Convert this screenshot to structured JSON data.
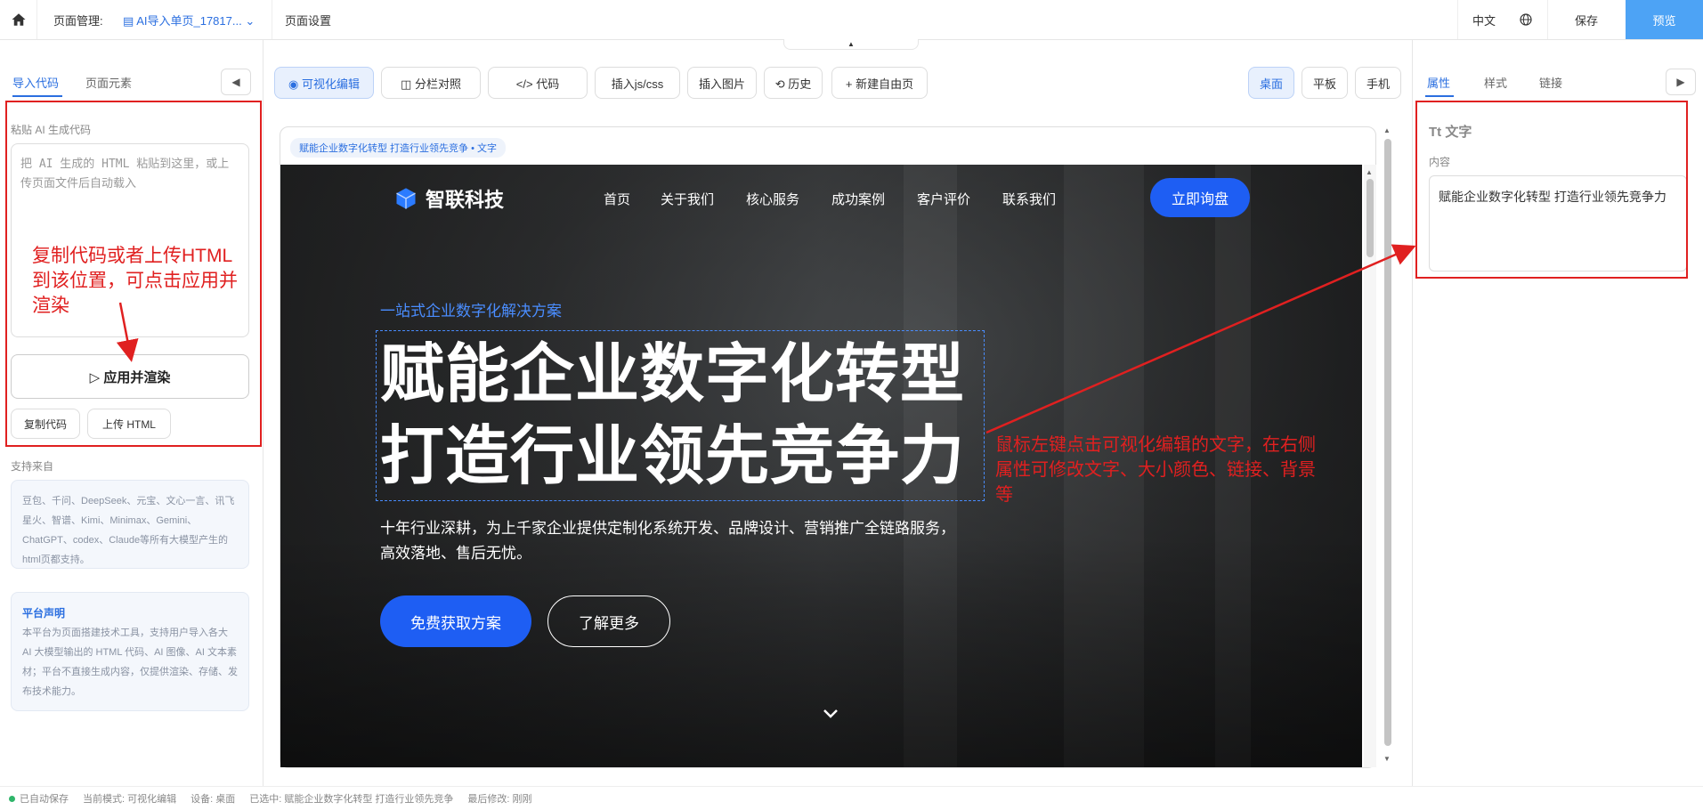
{
  "topbar": {
    "page_manage_label": "页面管理:",
    "page_name": "AI导入单页_17817...",
    "page_settings": "页面设置",
    "lang": "中文",
    "save": "保存",
    "preview": "预览"
  },
  "left_panel": {
    "tab_import": "导入代码",
    "tab_elements": "页面元素",
    "paste_label": "粘贴 AI 生成代码",
    "placeholder": "把 AI 生成的 HTML 粘贴到这里，或上传页面文件后自动载入",
    "apply_button": "▷ 应用并渲染",
    "copy_button": "复制代码",
    "upload_button": "上传 HTML",
    "support_label": "支持来自",
    "support_text": "豆包、千问、DeepSeek、元宝、文心一言、讯飞星火、智谱、Kimi、Minimax、Gemini、ChatGPT、codex、Claude等所有大模型产生的html页都支持。",
    "notice_title": "平台声明",
    "notice_text": "本平台为页面搭建技术工具，支持用户导入各大 AI 大模型输出的 HTML 代码、AI 图像、AI 文本素材；平台不直接生成内容，仅提供渲染、存储、发布技术能力。"
  },
  "toolbar": {
    "visual_edit": "◉ 可视化编辑",
    "split_view": "◫ 分栏对照",
    "code": "</> 代码",
    "insert_js": "插入js/css",
    "insert_img": "插入图片",
    "history": "⟲ 历史",
    "new_page": "+ 新建自由页",
    "desktop": "桌面",
    "tablet": "平板",
    "mobile": "手机"
  },
  "canvas": {
    "breadcrumb": "赋能企业数字化转型 打造行业领先竞争 • 文字",
    "brand": "智联科技",
    "nav": [
      "首页",
      "关于我们",
      "核心服务",
      "成功案例",
      "客户评价",
      "联系我们"
    ],
    "cta_top": "立即询盘",
    "kicker": "一站式企业数字化解决方案",
    "headline_line1": "赋能企业数字化转型",
    "headline_line2": "打造行业领先竞争力",
    "subtext": "十年行业深耕，为上千家企业提供定制化系统开发、品牌设计、营销推广全链路服务，高效落地、售后无忧。",
    "btn_primary": "免费获取方案",
    "btn_outline": "了解更多"
  },
  "right_panel": {
    "tab_props": "属性",
    "tab_style": "样式",
    "tab_link": "链接",
    "heading": "Tt 文字",
    "content_label": "内容",
    "content_value": "赋能企业数字化转型  打造行业领先竞争力"
  },
  "statusbar": {
    "saved": "已自动保存",
    "mode": "当前模式: 可视化编辑",
    "device": "设备: 桌面",
    "selected": "已选中: 赋能企业数字化转型 打造行业领先竞争",
    "modified": "最后修改: 刚刚"
  },
  "annotations": {
    "left_note": "复制代码或者上传HTML到该位置，可点击应用并渲染",
    "center_note": "鼠标左键点击可视化编辑的文字，在右侧属性可修改文字、大小颜色、链接、背景等"
  },
  "colors": {
    "accent": "#2b6fe0",
    "brand_blue": "#1e5ef3",
    "annotation_red": "#e02020",
    "preview_bg": "#4da3f5"
  }
}
